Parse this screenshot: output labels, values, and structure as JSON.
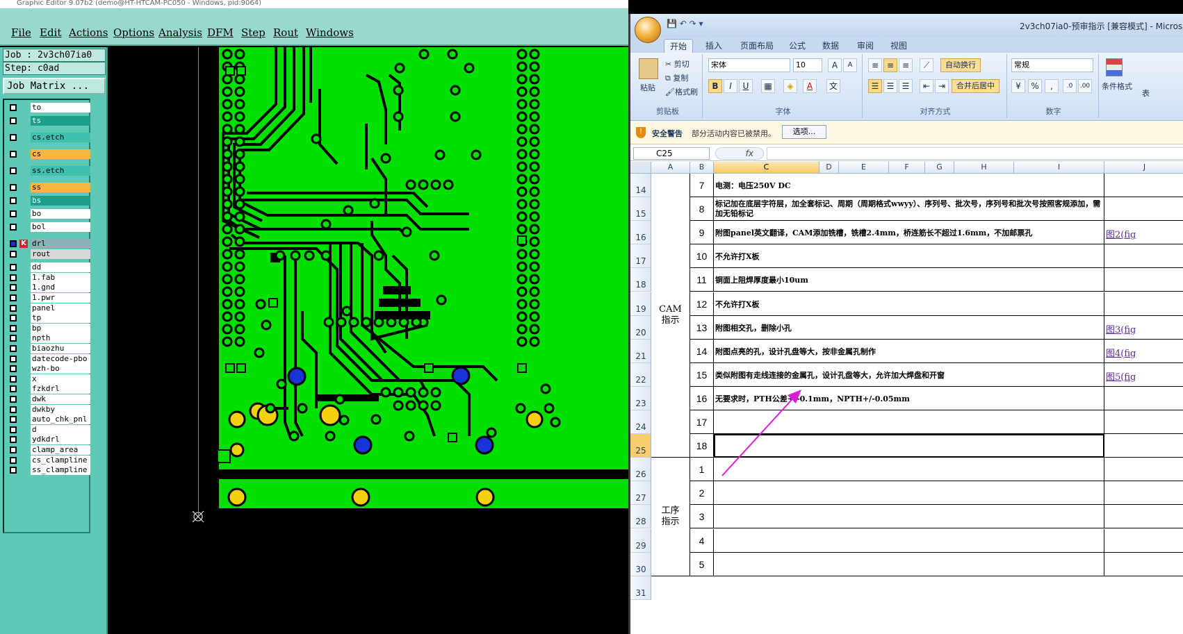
{
  "graphic_editor": {
    "title": "Graphic Editor 9.07b2 (demo@HT-HTCAM-PC050 - Windows, pid:9064)",
    "menu": [
      "File",
      "Edit",
      "Actions",
      "Options",
      "Analysis",
      "DFM",
      "Step",
      "Rout",
      "Windows"
    ],
    "job_label": "Job : 2v3ch07ia0",
    "step_label": "Step: c0ad",
    "job_matrix_button": "Job Matrix ...",
    "layers": [
      {
        "name": "to",
        "style": "white"
      },
      {
        "name": "ts",
        "style": "teal"
      },
      {
        "name": "cs.etch",
        "style": "cyan"
      },
      {
        "name": "cs",
        "style": "orange"
      },
      {
        "name": "ss.etch",
        "style": "cyan"
      },
      {
        "name": "ss",
        "style": "orange"
      },
      {
        "name": "bs",
        "style": "teal"
      },
      {
        "name": "bo",
        "style": "white"
      },
      {
        "name": "bol",
        "style": "white"
      },
      {
        "name": "drl",
        "style": "steel",
        "active": true,
        "marker": "K"
      },
      {
        "name": "rout",
        "style": "grey"
      },
      {
        "name": "dd",
        "style": "white"
      },
      {
        "name": "1.fab",
        "style": "white"
      },
      {
        "name": "1.gnd",
        "style": "white"
      },
      {
        "name": "1.pwr",
        "style": "white"
      },
      {
        "name": "panel",
        "style": "white"
      },
      {
        "name": "tp",
        "style": "white"
      },
      {
        "name": "bp",
        "style": "white"
      },
      {
        "name": "npth",
        "style": "white"
      },
      {
        "name": "biaozhu",
        "style": "white"
      },
      {
        "name": "datecode-pbo",
        "style": "white"
      },
      {
        "name": "wzh-bo",
        "style": "white"
      },
      {
        "name": "x",
        "style": "white"
      },
      {
        "name": "fzkdrl",
        "style": "white"
      },
      {
        "name": "dwk",
        "style": "white"
      },
      {
        "name": "dwkby",
        "style": "white"
      },
      {
        "name": "auto_chk_pnl",
        "style": "white"
      },
      {
        "name": "d",
        "style": "white"
      },
      {
        "name": "ydkdrl",
        "style": "white"
      },
      {
        "name": "clamp_area",
        "style": "white"
      },
      {
        "name": "cs_clampline",
        "style": "white"
      },
      {
        "name": "ss_clampline",
        "style": "white"
      }
    ],
    "colors": {
      "pcb_green": "#00e000",
      "pad_yellow": "#f3d20d",
      "via_blue": "#1a33d6",
      "menu_bg": "#98d9cd",
      "panel_bg": "#5fc9b7"
    }
  },
  "excel": {
    "document_title": "2v3ch07ia0-预审指示 [兼容模式] - Micros",
    "tabs": [
      "开始",
      "插入",
      "页面布局",
      "公式",
      "数据",
      "审阅",
      "视图"
    ],
    "active_tab": "开始",
    "ribbon": {
      "clipboard": {
        "paste": "粘贴",
        "cut": "剪切",
        "copy": "复制",
        "format_painter": "格式刷",
        "label": "剪贴板"
      },
      "font": {
        "name": "宋体",
        "size": "10",
        "bold": "B",
        "italic": "I",
        "underline": "U",
        "grow": "A",
        "shrink": "A",
        "label": "字体"
      },
      "alignment": {
        "wrap": "自动换行",
        "merge": "合并后居中",
        "label": "对齐方式"
      },
      "number": {
        "format": "常规",
        "percent": "%",
        "comma": ",",
        "label": "数字"
      },
      "styles": {
        "conditional": "条件格式",
        "label": "表"
      }
    },
    "security_bar": {
      "title": "安全警告",
      "message": "部分活动内容已被禁用。",
      "button": "选项..."
    },
    "name_box": "C25",
    "fx": "fx",
    "columns": [
      "A",
      "B",
      "C",
      "D",
      "E",
      "F",
      "G",
      "H",
      "I",
      "J"
    ],
    "row_numbers": [
      "14",
      "15",
      "16",
      "17",
      "18",
      "19",
      "20",
      "21",
      "22",
      "23",
      "24",
      "25",
      "26",
      "27",
      "28",
      "29",
      "30",
      "31"
    ],
    "section1_label": "CAM\n指示",
    "section2_label": "工序\n指示",
    "rows": [
      {
        "num": "7",
        "text": "电测：电压250V DC",
        "link": ""
      },
      {
        "num": "8",
        "text": "标记加在底层字符层，加全套标记、周期（周期格式wwyy）、序列号、批次号，序列号和批次号按照客规添加，需加无铅标记",
        "link": ""
      },
      {
        "num": "9",
        "text": "附图panel英文翻译，CAM添加铣槽，铣槽2.4mm，桥连筋长不超过1.6mm，不加邮票孔",
        "link": "图2(fig"
      },
      {
        "num": "10",
        "text": "不允许打X板",
        "link": ""
      },
      {
        "num": "11",
        "text": "铜面上阻焊厚度最小10um",
        "link": ""
      },
      {
        "num": "12",
        "text": "不允许打X板",
        "link": ""
      },
      {
        "num": "13",
        "text": "附图相交孔，删除小孔",
        "link": "图3(fig"
      },
      {
        "num": "14",
        "text": "附图点亮的孔，设计孔盘等大，按非金属孔制作",
        "link": "图4(fig"
      },
      {
        "num": "15",
        "text": "类似附图有走线连接的金属孔，设计孔盘等大，允许加大焊盘和开窗",
        "link": "图5(fig"
      },
      {
        "num": "16",
        "text": "无要求时，PTH公差+/-0.1mm，NPTH+/-0.05mm",
        "link": ""
      },
      {
        "num": "17",
        "text": "",
        "link": ""
      },
      {
        "num": "18",
        "text": "",
        "link": ""
      },
      {
        "num": "1",
        "text": "",
        "link": ""
      },
      {
        "num": "2",
        "text": "",
        "link": ""
      },
      {
        "num": "3",
        "text": "",
        "link": ""
      },
      {
        "num": "4",
        "text": "",
        "link": ""
      },
      {
        "num": "5",
        "text": "",
        "link": ""
      }
    ]
  }
}
